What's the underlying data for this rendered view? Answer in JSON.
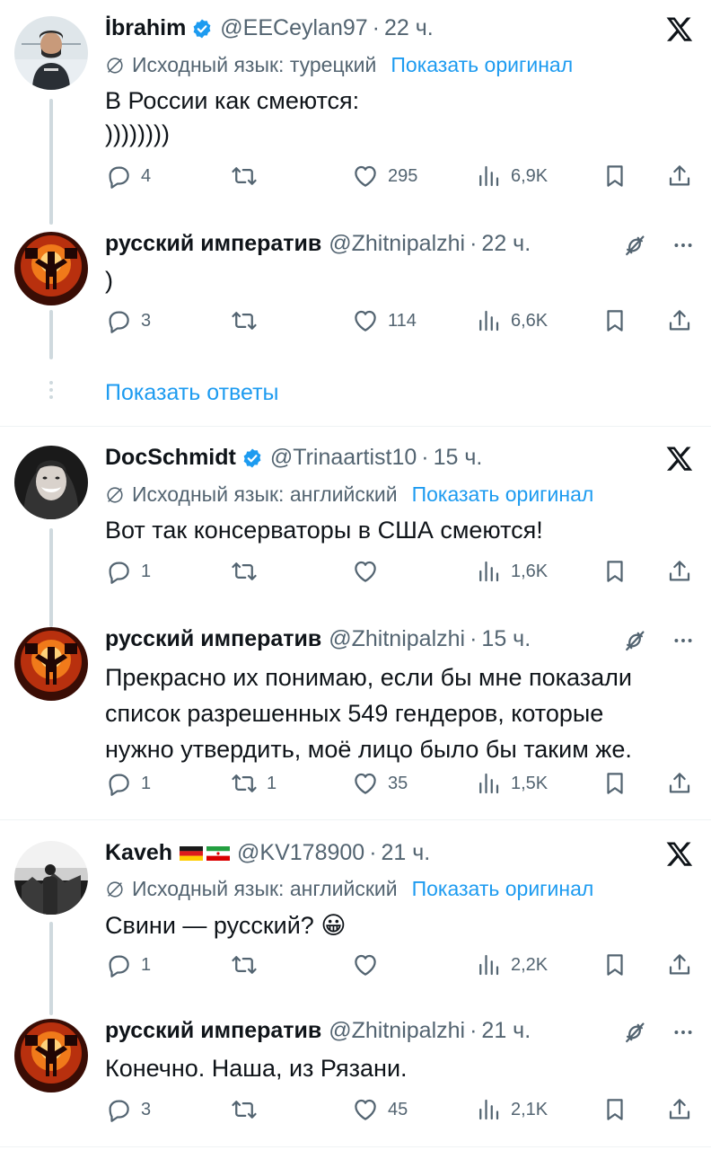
{
  "threads": [
    {
      "root": {
        "name": "İbrahim",
        "handle": "@EECeylan97",
        "dot": "·",
        "time": "22 ч.",
        "translation_note": "Исходный язык: турецкий",
        "show_original": "Показать оригинал",
        "text_lines": [
          "В России как смеются:",
          "))))))))"
        ],
        "replies": "4",
        "retweets": "",
        "likes": "295",
        "views": "6,9K"
      },
      "reply": {
        "name": "русский императив",
        "handle": "@Zhitnipalzhi",
        "dot": "·",
        "time": "22 ч.",
        "text_lines": [
          ")"
        ],
        "replies": "3",
        "retweets": "",
        "likes": "114",
        "views": "6,6K"
      },
      "show_replies": "Показать ответы"
    },
    {
      "root": {
        "name": "DocSchmidt",
        "handle": "@Trinaartist10",
        "dot": "·",
        "time": "15 ч.",
        "translation_note": "Исходный язык: английский",
        "show_original": "Показать оригинал",
        "text_lines": [
          "Вот так консерваторы в США смеются!"
        ],
        "replies": "1",
        "retweets": "",
        "likes": "",
        "views": "1,6K"
      },
      "reply": {
        "name": "русский императив",
        "handle": "@Zhitnipalzhi",
        "dot": "·",
        "time": "15 ч.",
        "text_lines": [
          "Прекрасно их понимаю, если бы мне показали",
          "список разрешенных 549 гендеров, которые",
          "нужно утвердить, моё лицо было бы таким же."
        ],
        "replies": "1",
        "retweets": "1",
        "likes": "35",
        "views": "1,5K"
      }
    },
    {
      "root": {
        "name": "Kaveh",
        "handle": "@KV178900",
        "dot": "·",
        "time": "21 ч.",
        "translation_note": "Исходный язык: английский",
        "show_original": "Показать оригинал",
        "text_lines": [
          "Свини — русский? 😀"
        ],
        "replies": "1",
        "retweets": "",
        "likes": "",
        "views": "2,2K"
      },
      "reply": {
        "name": "русский императив",
        "handle": "@Zhitnipalzhi",
        "dot": "·",
        "time": "21 ч.",
        "text_lines": [
          "Конечно. Наша, из Рязани."
        ],
        "replies": "3",
        "retweets": "",
        "likes": "45",
        "views": "2,1K"
      }
    }
  ],
  "colors": {
    "text": "#0f1419",
    "secondary": "#536471",
    "link": "#1d9bf0",
    "verified": "#1d9bf0",
    "thread_line": "#cfd9de"
  },
  "icons": [
    "verified-badge-icon",
    "x-logo-icon",
    "globe-icon",
    "reply-icon",
    "retweet-icon",
    "like-icon",
    "views-icon",
    "bookmark-icon",
    "share-icon",
    "grok-icon",
    "more-icon",
    "german-flag-icon",
    "iran-flag-icon"
  ]
}
